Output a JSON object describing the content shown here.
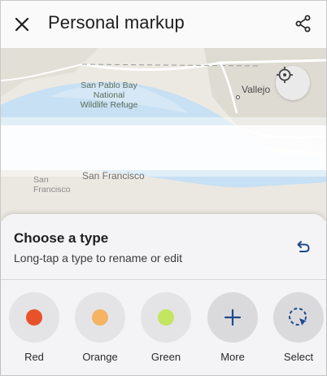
{
  "app_bar": {
    "title": "Personal markup",
    "close_icon": "close-icon",
    "share_icon": "share-icon"
  },
  "map": {
    "labels": {
      "refuge": "San Pablo Bay\nNational\nWildlife Refuge",
      "vallejo": "Vallejo",
      "san_francisco": "San Francisco",
      "san_francisco_ghost": "San\nFrancisco"
    },
    "locate_icon": "crosshair-icon"
  },
  "sheet": {
    "heading": "Choose a type",
    "subtitle": "Long-tap a type to rename or edit",
    "undo_icon": "undo-icon",
    "types": [
      {
        "label": "Red",
        "color": "#e8522a"
      },
      {
        "label": "Orange",
        "color": "#f4b462"
      },
      {
        "label": "Green",
        "color": "#c3e561"
      },
      {
        "label": "More",
        "icon": "plus-icon"
      },
      {
        "label": "Select",
        "icon": "select-icon"
      }
    ]
  },
  "colors": {
    "accent": "#1e4a8c",
    "water": "#c7e0f3"
  }
}
